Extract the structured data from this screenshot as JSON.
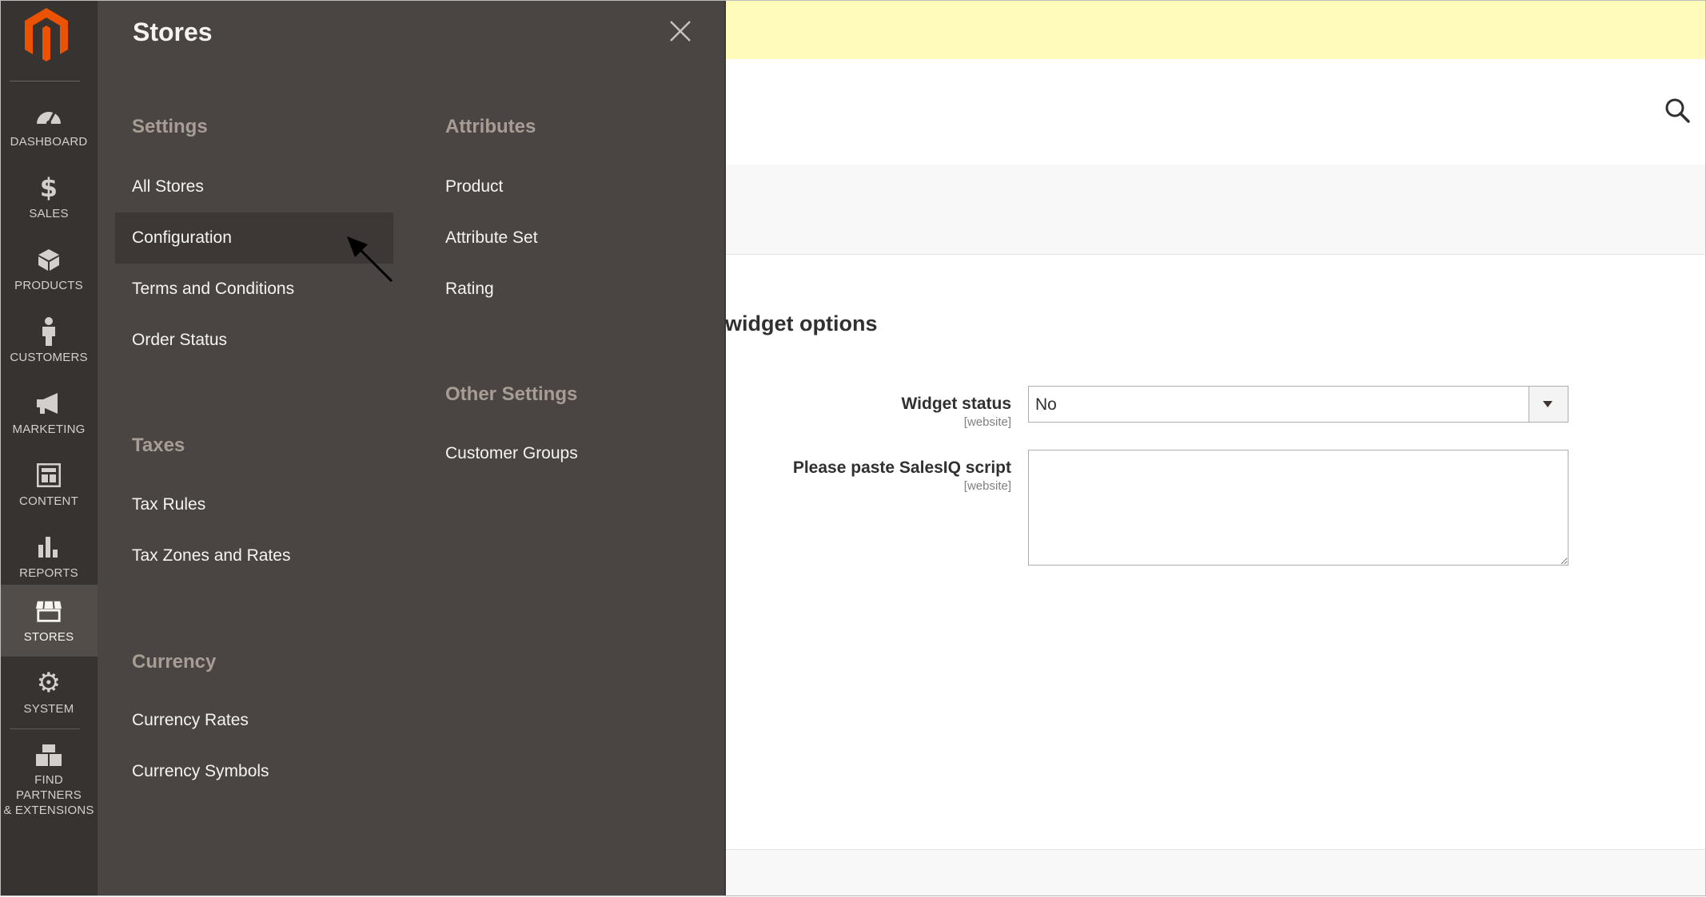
{
  "nav": {
    "items": [
      {
        "label": "DASHBOARD",
        "icon": "dashboard-icon"
      },
      {
        "label": "SALES",
        "icon": "dollar-icon"
      },
      {
        "label": "PRODUCTS",
        "icon": "cube-icon"
      },
      {
        "label": "CUSTOMERS",
        "icon": "person-icon"
      },
      {
        "label": "MARKETING",
        "icon": "megaphone-icon"
      },
      {
        "label": "CONTENT",
        "icon": "layout-icon"
      },
      {
        "label": "REPORTS",
        "icon": "bar-chart-icon"
      },
      {
        "label": "STORES",
        "icon": "storefront-icon"
      },
      {
        "label": "SYSTEM",
        "icon": "gear-icon"
      }
    ],
    "partners": {
      "line1": "FIND PARTNERS",
      "line2": "& EXTENSIONS",
      "icon": "boxes-icon"
    },
    "active": "STORES"
  },
  "panel": {
    "title": "Stores",
    "settings": {
      "title": "Settings",
      "links": [
        "All Stores",
        "Configuration",
        "Terms and Conditions",
        "Order Status"
      ]
    },
    "taxes": {
      "title": "Taxes",
      "links": [
        "Tax Rules",
        "Tax Zones and Rates"
      ]
    },
    "currency": {
      "title": "Currency",
      "links": [
        "Currency Rates",
        "Currency Symbols"
      ]
    },
    "attributes": {
      "title": "Attributes",
      "links": [
        "Product",
        "Attribute Set",
        "Rating"
      ]
    },
    "other": {
      "title": "Other Settings",
      "links": [
        "Customer Groups"
      ]
    }
  },
  "content": {
    "section_title": "widget options",
    "widget_status": {
      "label": "Widget status",
      "scope": "[website]",
      "value": "No"
    },
    "script": {
      "label": "Please paste SalesIQ script",
      "scope": "[website]",
      "value": ""
    }
  },
  "colors": {
    "nav_bg": "#373330",
    "panel_bg": "#4a4542",
    "logo": "#eb5202",
    "notice_bg": "#fffbbb"
  }
}
